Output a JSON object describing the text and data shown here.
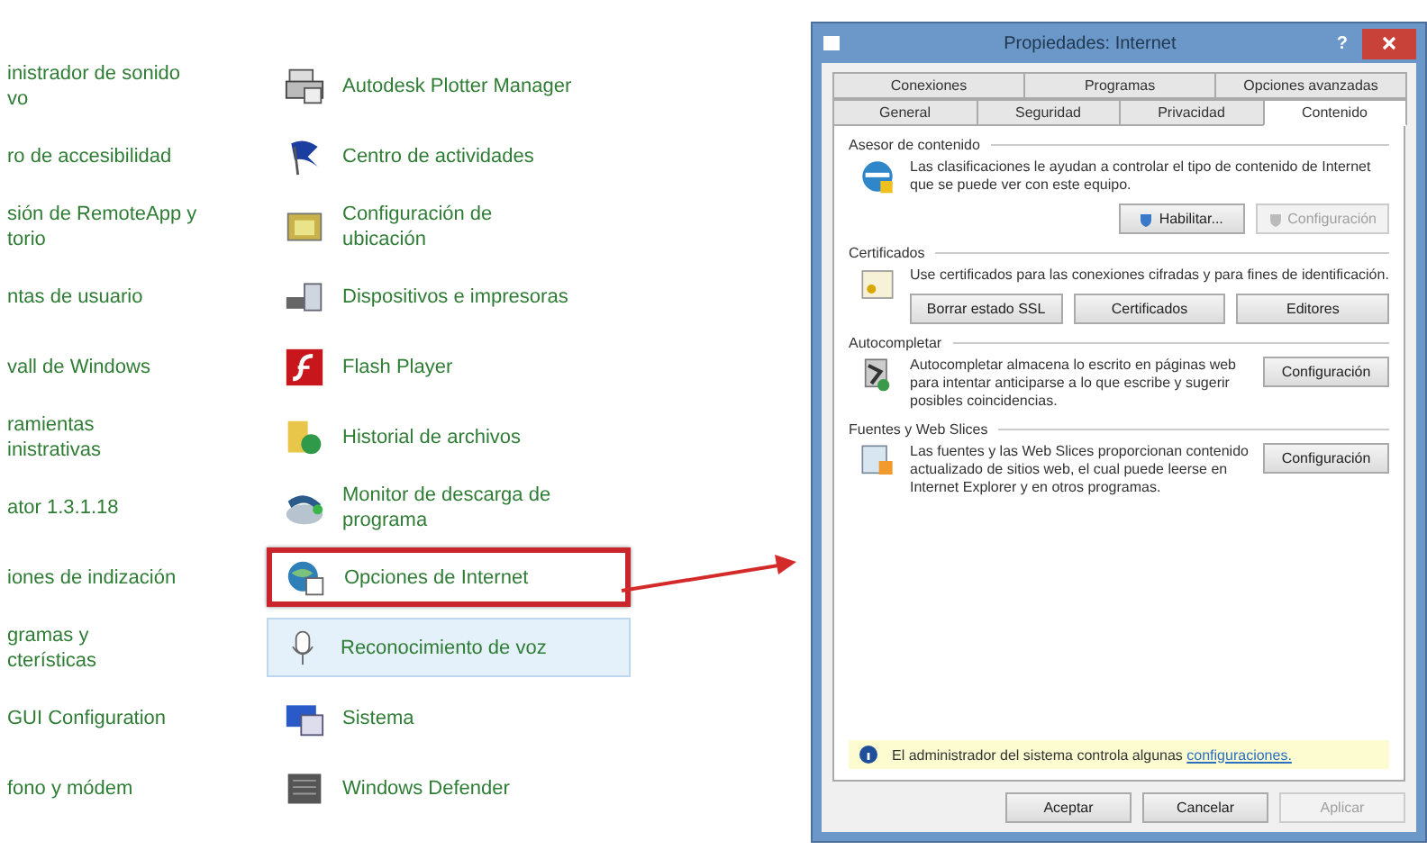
{
  "control_panel": {
    "rows": [
      {
        "left": "inistrador de sonido\nvo",
        "right": {
          "label": "Autodesk Plotter Manager",
          "kind": "plotter",
          "highlighted": false,
          "hovered": false
        }
      },
      {
        "left": "ro de accesibilidad",
        "right": {
          "label": "Centro de actividades",
          "kind": "flag",
          "highlighted": false,
          "hovered": false
        }
      },
      {
        "left": "sión de RemoteApp y\ntorio",
        "right": {
          "label": "Configuración de\nubicación",
          "kind": "location",
          "highlighted": false,
          "hovered": false
        }
      },
      {
        "left": "ntas de usuario",
        "right": {
          "label": "Dispositivos e impresoras",
          "kind": "devices",
          "highlighted": false,
          "hovered": false
        }
      },
      {
        "left": "vall de Windows",
        "right": {
          "label": "Flash Player",
          "kind": "flash",
          "highlighted": false,
          "hovered": false
        }
      },
      {
        "left": "ramientas\ninistrativas",
        "right": {
          "label": "Historial de archivos",
          "kind": "history",
          "highlighted": false,
          "hovered": false
        }
      },
      {
        "left": "ator 1.3.1.18",
        "right": {
          "label": "Monitor de descarga de\nprograma",
          "kind": "download",
          "highlighted": false,
          "hovered": false
        }
      },
      {
        "left": "iones de indización",
        "right": {
          "label": "Opciones de Internet",
          "kind": "internet",
          "highlighted": true,
          "hovered": false
        }
      },
      {
        "left": "gramas y\ncterísticas",
        "right": {
          "label": "Reconocimiento de voz",
          "kind": "mic",
          "highlighted": false,
          "hovered": true
        }
      },
      {
        "left": "GUI Configuration",
        "right": {
          "label": "Sistema",
          "kind": "system",
          "highlighted": false,
          "hovered": false
        }
      },
      {
        "left": "fono y módem",
        "right": {
          "label": "Windows Defender",
          "kind": "defender",
          "highlighted": false,
          "hovered": false
        }
      }
    ]
  },
  "dialog": {
    "title": "Propiedades: Internet",
    "help": "?",
    "tab_rows": [
      [
        {
          "label": "Conexiones",
          "selected": false
        },
        {
          "label": "Programas",
          "selected": false
        },
        {
          "label": "Opciones avanzadas",
          "selected": false
        }
      ],
      [
        {
          "label": "General",
          "selected": false
        },
        {
          "label": "Seguridad",
          "selected": false
        },
        {
          "label": "Privacidad",
          "selected": false
        },
        {
          "label": "Contenido",
          "selected": true
        }
      ]
    ],
    "groups": [
      {
        "title": "Asesor de contenido",
        "kind": "ie",
        "text": "Las clasificaciones le ayudan a controlar el tipo de contenido de Internet que se puede ver con este equipo.",
        "buttons": [
          {
            "label": "Habilitar...",
            "shield": true,
            "disabled": false
          },
          {
            "label": "Configuración",
            "shield": true,
            "disabled": true
          }
        ]
      },
      {
        "title": "Certificados",
        "kind": "cert",
        "text": "Use certificados para las conexiones cifradas y para fines de identificación.",
        "buttons": [
          {
            "label": "Borrar estado SSL",
            "shield": false,
            "disabled": false
          },
          {
            "label": "Certificados",
            "shield": false,
            "disabled": false
          },
          {
            "label": "Editores",
            "shield": false,
            "disabled": false
          }
        ]
      },
      {
        "title": "Autocompletar",
        "kind": "autocomplete",
        "text": "Autocompletar almacena lo escrito en páginas web para intentar anticiparse a lo que escribe y sugerir posibles coincidencias.",
        "buttons": [
          {
            "label": "Configuración",
            "shield": false,
            "disabled": false
          }
        ]
      },
      {
        "title": "Fuentes y Web Slices",
        "kind": "feeds",
        "text": "Las fuentes y las Web Slices proporcionan contenido actualizado de sitios web, el cual puede leerse en Internet Explorer y en otros programas.",
        "buttons": [
          {
            "label": "Configuración",
            "shield": false,
            "disabled": false
          }
        ]
      }
    ],
    "notice": {
      "text": "El administrador del sistema controla algunas",
      "link": "configuraciones."
    },
    "buttons": [
      {
        "label": "Aceptar",
        "disabled": false
      },
      {
        "label": "Cancelar",
        "disabled": false
      },
      {
        "label": "Aplicar",
        "disabled": true
      }
    ]
  }
}
